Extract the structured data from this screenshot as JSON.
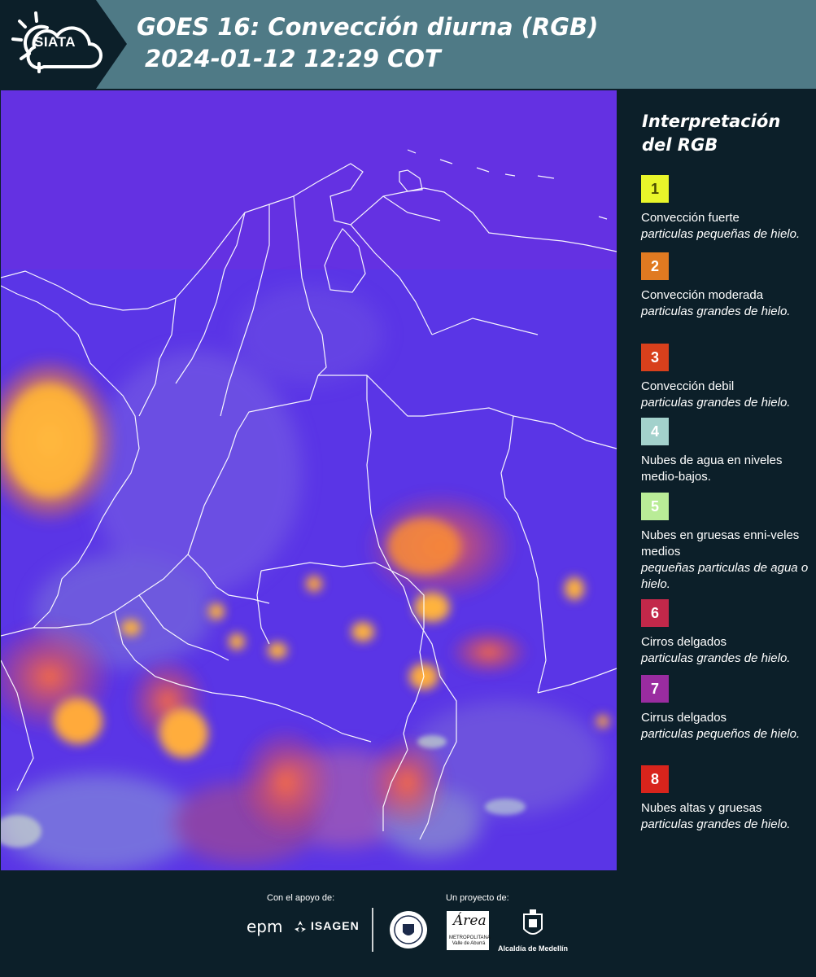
{
  "header": {
    "logo_text": "SIATA",
    "title_line1": "GOES 16: Convección diurna (RGB)",
    "title_line2": "2024-01-12 12:29 COT"
  },
  "legend": {
    "title": "Interpretación del RGB",
    "items": [
      {
        "number": "1",
        "color": "#e9f52a",
        "number_color": "#4a4a00",
        "name": "Convección fuerte",
        "desc": "particulas pequeñas de hielo."
      },
      {
        "number": "2",
        "color": "#e07a21",
        "number_color": "#ffffff",
        "name": "Convección moderada",
        "desc": "particulas grandes de hielo."
      },
      {
        "number": "3",
        "color": "#d8401c",
        "number_color": "#ffffff",
        "name": "Convección debil",
        "desc": "particulas grandes de hielo."
      },
      {
        "number": "4",
        "color": "#a3d1cc",
        "number_color": "#ffffff",
        "name": "Nubes de agua en niveles medio-bajos.",
        "desc": ""
      },
      {
        "number": "5",
        "color": "#b9ec97",
        "number_color": "#ffffff",
        "name": "Nubes en gruesas enni-veles medios",
        "desc": "pequeñas particulas de agua o hielo."
      },
      {
        "number": "6",
        "color": "#c2284a",
        "number_color": "#ffffff",
        "name": "Cirros delgados",
        "desc": "particulas grandes de hielo."
      },
      {
        "number": "7",
        "color": "#9a2ca0",
        "number_color": "#ffffff",
        "name": "Cirrus delgados",
        "desc": "particulas pequeños de hielo."
      },
      {
        "number": "8",
        "color": "#d8241c",
        "number_color": "#ffffff",
        "name": "Nubes altas y gruesas",
        "desc": "particulas grandes de hielo."
      }
    ]
  },
  "footer": {
    "support_label": "Con el apoyo de:",
    "project_label": "Un proyecto de:",
    "epm": "epm",
    "isagen": "ISAGEN",
    "area_script": "Área",
    "area_sub": "METROPOLITANA Valle de Aburrá",
    "alcaldia": "Alcaldía de Medellín"
  }
}
